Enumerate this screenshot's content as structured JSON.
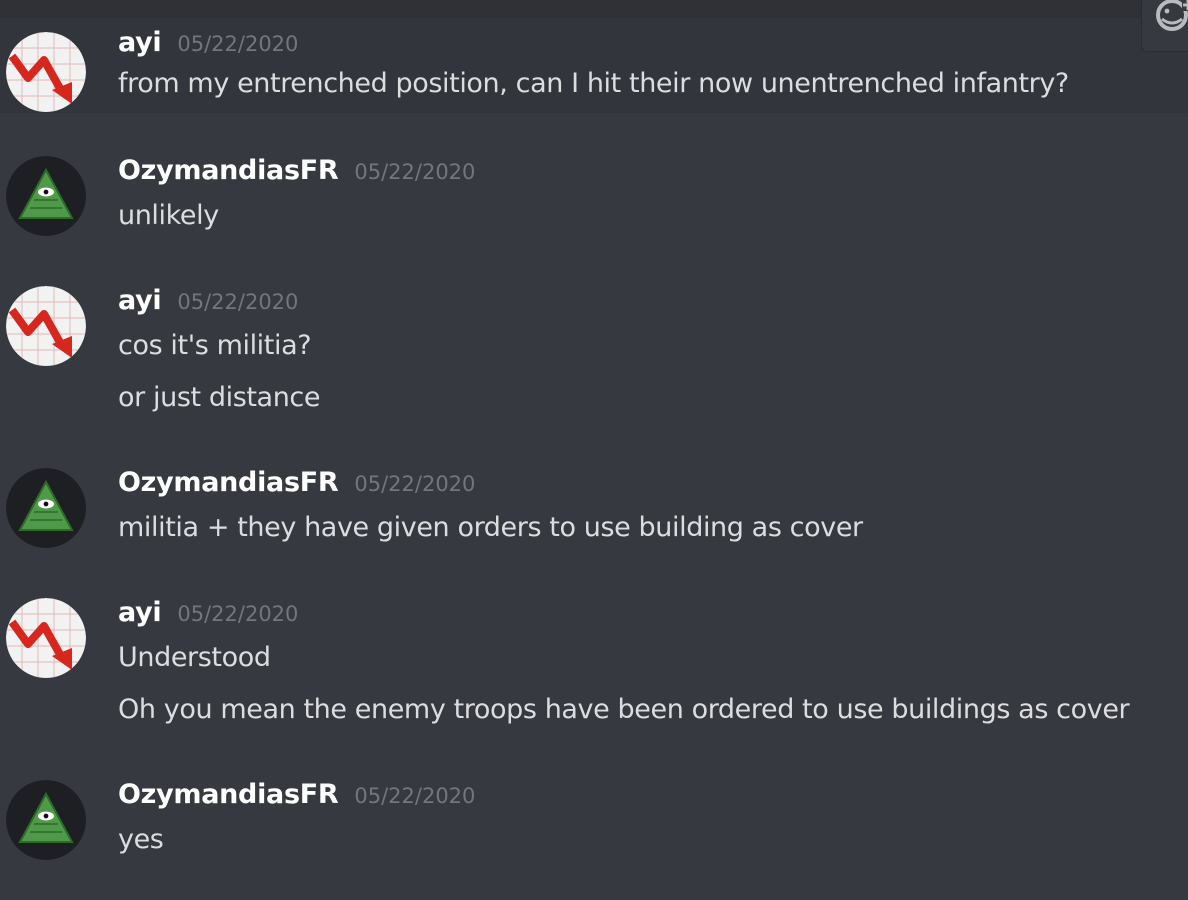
{
  "colors": {
    "background": "#36393f",
    "hover_background": "#32353b",
    "username": "#ffffff",
    "timestamp": "#72767d",
    "message_text": "#dcddde"
  },
  "toolbar": {
    "add_reaction_icon": "add-reaction-icon"
  },
  "messages": [
    {
      "author": "ayi",
      "avatar_icon": "red-downtrend-arrow-icon",
      "timestamp": "05/22/2020",
      "lines": [
        "from my entrenched position, can I hit their now unentrenched infantry?"
      ]
    },
    {
      "author": "OzymandiasFR",
      "avatar_icon": "eye-pyramid-icon",
      "timestamp": "05/22/2020",
      "lines": [
        "unlikely"
      ]
    },
    {
      "author": "ayi",
      "avatar_icon": "red-downtrend-arrow-icon",
      "timestamp": "05/22/2020",
      "lines": [
        "cos it's militia?",
        "or just distance"
      ]
    },
    {
      "author": "OzymandiasFR",
      "avatar_icon": "eye-pyramid-icon",
      "timestamp": "05/22/2020",
      "lines": [
        "militia + they have given orders to use building as cover"
      ]
    },
    {
      "author": "ayi",
      "avatar_icon": "red-downtrend-arrow-icon",
      "timestamp": "05/22/2020",
      "lines": [
        "Understood",
        "Oh you mean the enemy troops have been ordered to use buildings as cover"
      ]
    },
    {
      "author": "OzymandiasFR",
      "avatar_icon": "eye-pyramid-icon",
      "timestamp": "05/22/2020",
      "lines": [
        "yes"
      ]
    }
  ]
}
